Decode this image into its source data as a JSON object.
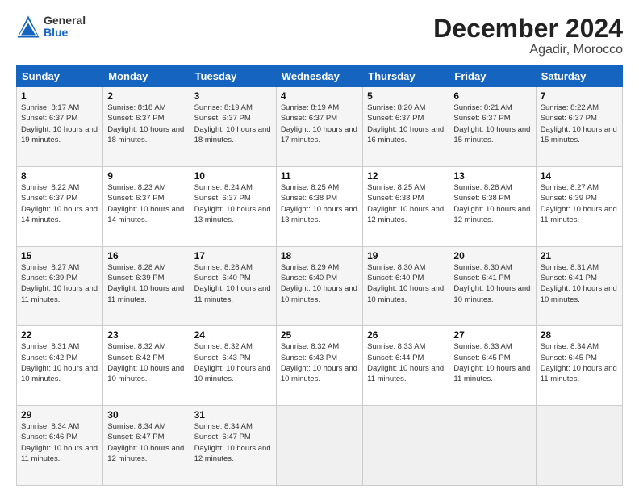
{
  "logo": {
    "general": "General",
    "blue": "Blue"
  },
  "title": "December 2024",
  "subtitle": "Agadir, Morocco",
  "days_header": [
    "Sunday",
    "Monday",
    "Tuesday",
    "Wednesday",
    "Thursday",
    "Friday",
    "Saturday"
  ],
  "weeks": [
    [
      {
        "day": "1",
        "sunrise": "8:17 AM",
        "sunset": "6:37 PM",
        "daylight": "10 hours and 19 minutes."
      },
      {
        "day": "2",
        "sunrise": "8:18 AM",
        "sunset": "6:37 PM",
        "daylight": "10 hours and 18 minutes."
      },
      {
        "day": "3",
        "sunrise": "8:19 AM",
        "sunset": "6:37 PM",
        "daylight": "10 hours and 18 minutes."
      },
      {
        "day": "4",
        "sunrise": "8:19 AM",
        "sunset": "6:37 PM",
        "daylight": "10 hours and 17 minutes."
      },
      {
        "day": "5",
        "sunrise": "8:20 AM",
        "sunset": "6:37 PM",
        "daylight": "10 hours and 16 minutes."
      },
      {
        "day": "6",
        "sunrise": "8:21 AM",
        "sunset": "6:37 PM",
        "daylight": "10 hours and 15 minutes."
      },
      {
        "day": "7",
        "sunrise": "8:22 AM",
        "sunset": "6:37 PM",
        "daylight": "10 hours and 15 minutes."
      }
    ],
    [
      {
        "day": "8",
        "sunrise": "8:22 AM",
        "sunset": "6:37 PM",
        "daylight": "10 hours and 14 minutes."
      },
      {
        "day": "9",
        "sunrise": "8:23 AM",
        "sunset": "6:37 PM",
        "daylight": "10 hours and 14 minutes."
      },
      {
        "day": "10",
        "sunrise": "8:24 AM",
        "sunset": "6:37 PM",
        "daylight": "10 hours and 13 minutes."
      },
      {
        "day": "11",
        "sunrise": "8:25 AM",
        "sunset": "6:38 PM",
        "daylight": "10 hours and 13 minutes."
      },
      {
        "day": "12",
        "sunrise": "8:25 AM",
        "sunset": "6:38 PM",
        "daylight": "10 hours and 12 minutes."
      },
      {
        "day": "13",
        "sunrise": "8:26 AM",
        "sunset": "6:38 PM",
        "daylight": "10 hours and 12 minutes."
      },
      {
        "day": "14",
        "sunrise": "8:27 AM",
        "sunset": "6:39 PM",
        "daylight": "10 hours and 11 minutes."
      }
    ],
    [
      {
        "day": "15",
        "sunrise": "8:27 AM",
        "sunset": "6:39 PM",
        "daylight": "10 hours and 11 minutes."
      },
      {
        "day": "16",
        "sunrise": "8:28 AM",
        "sunset": "6:39 PM",
        "daylight": "10 hours and 11 minutes."
      },
      {
        "day": "17",
        "sunrise": "8:28 AM",
        "sunset": "6:40 PM",
        "daylight": "10 hours and 11 minutes."
      },
      {
        "day": "18",
        "sunrise": "8:29 AM",
        "sunset": "6:40 PM",
        "daylight": "10 hours and 10 minutes."
      },
      {
        "day": "19",
        "sunrise": "8:30 AM",
        "sunset": "6:40 PM",
        "daylight": "10 hours and 10 minutes."
      },
      {
        "day": "20",
        "sunrise": "8:30 AM",
        "sunset": "6:41 PM",
        "daylight": "10 hours and 10 minutes."
      },
      {
        "day": "21",
        "sunrise": "8:31 AM",
        "sunset": "6:41 PM",
        "daylight": "10 hours and 10 minutes."
      }
    ],
    [
      {
        "day": "22",
        "sunrise": "8:31 AM",
        "sunset": "6:42 PM",
        "daylight": "10 hours and 10 minutes."
      },
      {
        "day": "23",
        "sunrise": "8:32 AM",
        "sunset": "6:42 PM",
        "daylight": "10 hours and 10 minutes."
      },
      {
        "day": "24",
        "sunrise": "8:32 AM",
        "sunset": "6:43 PM",
        "daylight": "10 hours and 10 minutes."
      },
      {
        "day": "25",
        "sunrise": "8:32 AM",
        "sunset": "6:43 PM",
        "daylight": "10 hours and 10 minutes."
      },
      {
        "day": "26",
        "sunrise": "8:33 AM",
        "sunset": "6:44 PM",
        "daylight": "10 hours and 11 minutes."
      },
      {
        "day": "27",
        "sunrise": "8:33 AM",
        "sunset": "6:45 PM",
        "daylight": "10 hours and 11 minutes."
      },
      {
        "day": "28",
        "sunrise": "8:34 AM",
        "sunset": "6:45 PM",
        "daylight": "10 hours and 11 minutes."
      }
    ],
    [
      {
        "day": "29",
        "sunrise": "8:34 AM",
        "sunset": "6:46 PM",
        "daylight": "10 hours and 11 minutes."
      },
      {
        "day": "30",
        "sunrise": "8:34 AM",
        "sunset": "6:47 PM",
        "daylight": "10 hours and 12 minutes."
      },
      {
        "day": "31",
        "sunrise": "8:34 AM",
        "sunset": "6:47 PM",
        "daylight": "10 hours and 12 minutes."
      },
      null,
      null,
      null,
      null
    ]
  ]
}
